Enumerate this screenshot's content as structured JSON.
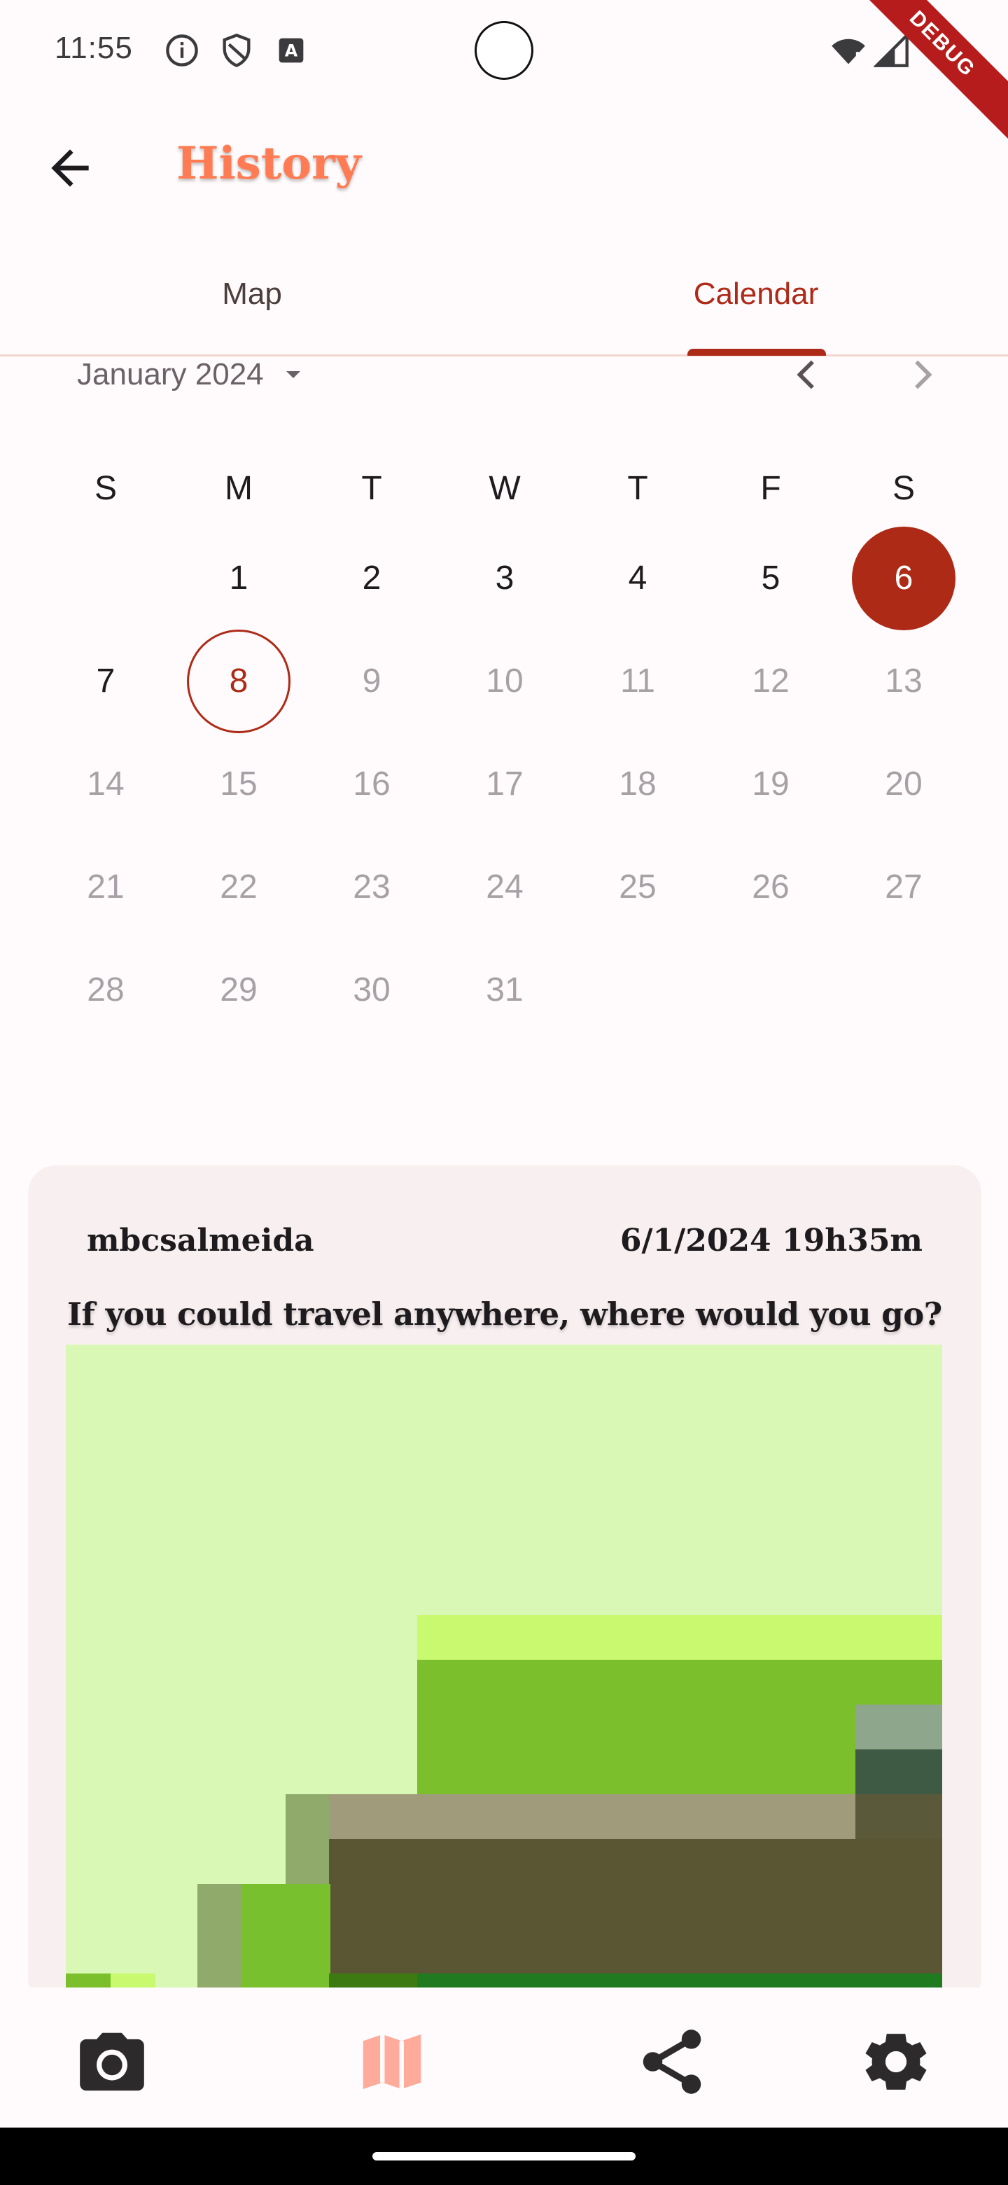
{
  "status_bar": {
    "time": "11:55",
    "icons": [
      "info-icon",
      "shield-icon",
      "keyboard-a-icon",
      "wifi-icon",
      "signal-icon"
    ],
    "debug_label": "DEBUG"
  },
  "app_bar": {
    "title": "History",
    "back_icon": "arrow-back-icon"
  },
  "tabs": [
    {
      "label": "Map",
      "selected": false
    },
    {
      "label": "Calendar",
      "selected": true
    }
  ],
  "calendar": {
    "month_label": "January 2024",
    "weekdays": [
      "S",
      "M",
      "T",
      "W",
      "T",
      "F",
      "S"
    ],
    "selected_day": "6",
    "today": "8",
    "weeks": [
      [
        "",
        "1",
        "2",
        "3",
        "4",
        "5",
        "6"
      ],
      [
        "7",
        "8",
        "9",
        "10",
        "11",
        "12",
        "13"
      ],
      [
        "14",
        "15",
        "16",
        "17",
        "18",
        "19",
        "20"
      ],
      [
        "21",
        "22",
        "23",
        "24",
        "25",
        "26",
        "27"
      ],
      [
        "28",
        "29",
        "30",
        "31",
        "",
        "",
        ""
      ]
    ],
    "enabled_days": [
      "1",
      "2",
      "3",
      "4",
      "5",
      "6",
      "7",
      "8"
    ]
  },
  "entry_card": {
    "username": "mbcsalmeida",
    "datetime": "6/1/2024 19h35m",
    "prompt": "If you could travel anywhere, where would you go?"
  },
  "bottom_nav": {
    "items": [
      {
        "icon": "camera-icon",
        "active": false
      },
      {
        "icon": "map-icon",
        "active": true
      },
      {
        "icon": "share-icon",
        "active": false
      },
      {
        "icon": "settings-icon",
        "active": false
      }
    ]
  },
  "colors": {
    "accent": "#ad2a17",
    "title": "#ff7b54",
    "map_icon_active": "#ffab9b"
  }
}
